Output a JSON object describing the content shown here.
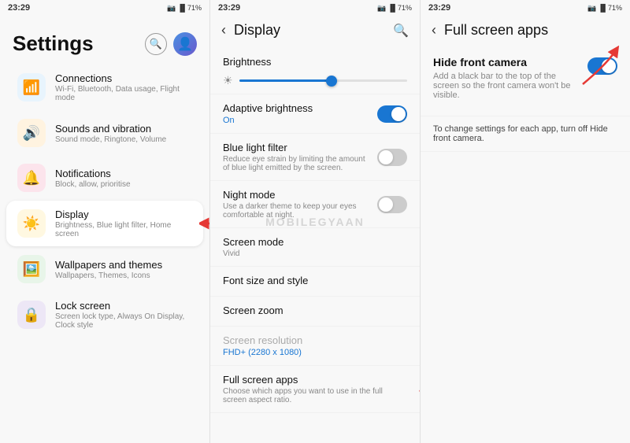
{
  "panels": {
    "panel1": {
      "status": {
        "time": "23:29",
        "icons": "📷 🔒 ●"
      },
      "title": "Settings",
      "items": [
        {
          "id": "connections",
          "icon": "wifi",
          "title": "Connections",
          "sub": "Wi-Fi, Bluetooth, Data usage, Flight mode",
          "iconClass": "icon-connections"
        },
        {
          "id": "sound",
          "icon": "🔔",
          "title": "Sounds and vibration",
          "sub": "Sound mode, Ringtone, Volume",
          "iconClass": "icon-sound"
        },
        {
          "id": "notifications",
          "icon": "🔴",
          "title": "Notifications",
          "sub": "Block, allow, prioritise",
          "iconClass": "icon-notifications"
        },
        {
          "id": "display",
          "icon": "☀️",
          "title": "Display",
          "sub": "Brightness, Blue light filter, Home screen",
          "iconClass": "icon-display",
          "active": true
        },
        {
          "id": "wallpaper",
          "icon": "🖼️",
          "title": "Wallpapers and themes",
          "sub": "Wallpapers, Themes, Icons",
          "iconClass": "icon-wallpaper"
        },
        {
          "id": "lock",
          "icon": "🔒",
          "title": "Lock screen",
          "sub": "Screen lock type, Always On Display, Clock style",
          "iconClass": "icon-lock"
        }
      ]
    },
    "panel2": {
      "status": {
        "time": "23:29"
      },
      "title": "Display",
      "sections": {
        "brightness": {
          "label": "Brightness",
          "sliderValue": 55
        },
        "adaptive": {
          "title": "Adaptive brightness",
          "accent": "On",
          "toggleOn": true
        },
        "bluelight": {
          "title": "Blue light filter",
          "desc": "Reduce eye strain by limiting the amount of blue light emitted by the screen.",
          "toggleOn": false
        },
        "nightmode": {
          "title": "Night mode",
          "desc": "Use a darker theme to keep your eyes comfortable at night.",
          "toggleOn": false
        },
        "screenmode": {
          "title": "Screen mode",
          "sub": "Vivid"
        },
        "fontsize": {
          "title": "Font size and style"
        },
        "screenzoom": {
          "title": "Screen zoom"
        },
        "screenresolution": {
          "title": "Screen resolution",
          "sub": "FHD+ (2280 x 1080)",
          "grayed": true
        },
        "fullscreen": {
          "title": "Full screen apps",
          "desc": "Choose which apps you want to use in the full screen aspect ratio."
        }
      }
    },
    "panel3": {
      "status": {
        "time": "23:29"
      },
      "title": "Full screen apps",
      "hide_camera": {
        "title": "Hide front camera",
        "desc": "Add a black bar to the top of the screen so the front camera won't be visible.",
        "toggleOn": true
      },
      "settings_text": "To change settings for each app, turn off Hide front camera."
    }
  },
  "watermark": "MOBILEGYAAN",
  "icons": {
    "wifi": "📶",
    "sound": "🔊",
    "bell": "🔔",
    "sun": "☀",
    "picture": "🖼",
    "lock": "🔒",
    "search": "🔍",
    "back": "‹",
    "small_sun": "☀",
    "sun_small": "✦"
  }
}
